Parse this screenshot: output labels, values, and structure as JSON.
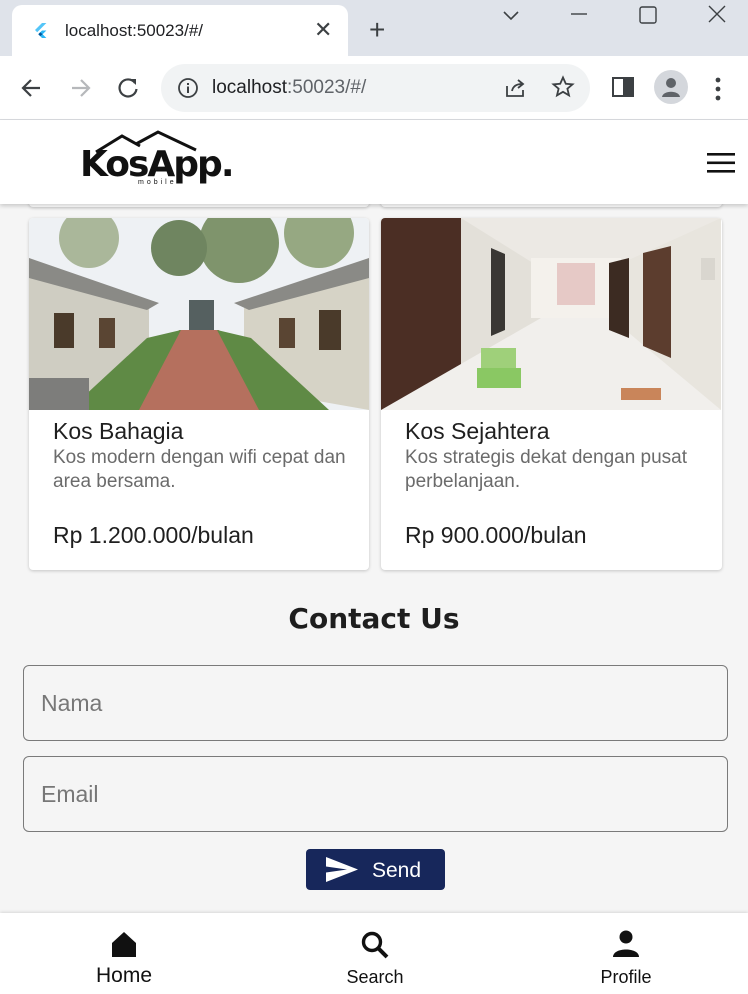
{
  "browser": {
    "tab_title": "localhost:50023/#/",
    "url_host": "localhost",
    "url_rest": ":50023/#/"
  },
  "app": {
    "logo_text": "KosApp.",
    "logo_sub": "mobile"
  },
  "listings": [
    {
      "name": "Kos Bahagia",
      "description": "Kos modern dengan wifi cepat dan area bersama.",
      "price": "Rp 1.200.000/bulan"
    },
    {
      "name": "Kos Sejahtera",
      "description": "Kos strategis dekat dengan pusat perbelanjaan.",
      "price": "Rp 900.000/bulan"
    }
  ],
  "contact": {
    "title": "Contact Us",
    "name_placeholder": "Nama",
    "email_placeholder": "Email",
    "send_label": "Send"
  },
  "bottom_nav": {
    "items": [
      {
        "label": "Home",
        "icon": "home-icon",
        "active": true
      },
      {
        "label": "Search",
        "icon": "search-icon",
        "active": false
      },
      {
        "label": "Profile",
        "icon": "person-icon",
        "active": false
      }
    ]
  },
  "colors": {
    "primary": "#17275b",
    "background": "#f5f5f5"
  }
}
